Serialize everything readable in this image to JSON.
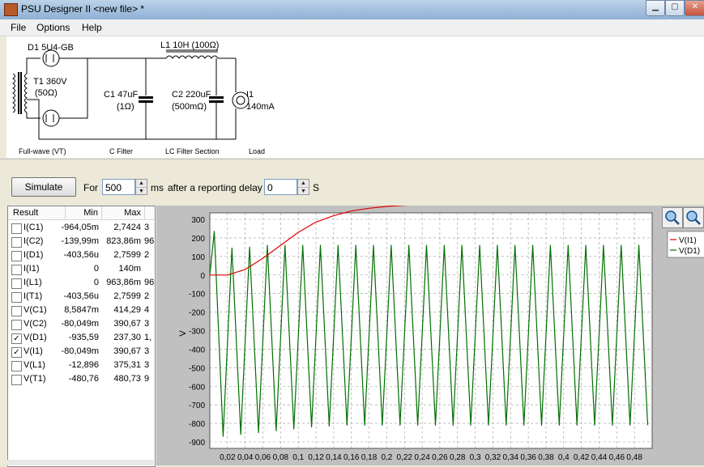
{
  "window": {
    "title": "PSU Designer II  <new file> *"
  },
  "menu": [
    "File",
    "Options",
    "Help"
  ],
  "schematic": {
    "d1_label": "D1 5U4-GB",
    "t1_label": "T1 360V",
    "t1_res": "(50Ω)",
    "l1_label": "L1 10H (100Ω)",
    "c1_label": "C1 47uF",
    "c1_res": "(1Ω)",
    "c2_label": "C2 220uF",
    "c2_res": "(500mΩ)",
    "i1_label": "I1",
    "i1_val": "140mA",
    "sections": [
      "Full-wave (VT)",
      "C Filter",
      "LC Filter Section",
      "Load"
    ]
  },
  "controls": {
    "simulate": "Simulate",
    "for_label": "For",
    "duration": "500",
    "ms_label": "ms",
    "delay_label": "after a reporting delay of",
    "delay": "0",
    "s_label": "S"
  },
  "results": {
    "headers": [
      "Result",
      "Min",
      "Max"
    ],
    "rows": [
      {
        "name": "I(C1)",
        "min": "-964,05m",
        "max": "2,7424",
        "extra": "3",
        "checked": false
      },
      {
        "name": "I(C2)",
        "min": "-139,99m",
        "max": "823,86m",
        "extra": "96",
        "checked": false
      },
      {
        "name": "I(D1)",
        "min": "-403,56u",
        "max": "2,7599",
        "extra": "2",
        "checked": false
      },
      {
        "name": "I(I1)",
        "min": "0",
        "max": "140m",
        "extra": "",
        "checked": false
      },
      {
        "name": "I(L1)",
        "min": "0",
        "max": "963,86m",
        "extra": "96",
        "checked": false
      },
      {
        "name": "I(T1)",
        "min": "-403,56u",
        "max": "2,7599",
        "extra": "2",
        "checked": false
      },
      {
        "name": "V(C1)",
        "min": "8,5847m",
        "max": "414,29",
        "extra": "4",
        "checked": false
      },
      {
        "name": "V(C2)",
        "min": "-80,049m",
        "max": "390,67",
        "extra": "3",
        "checked": false
      },
      {
        "name": "V(D1)",
        "min": "-935,59",
        "max": "237,30",
        "extra": "1,",
        "checked": true
      },
      {
        "name": "V(I1)",
        "min": "-80,049m",
        "max": "390,67",
        "extra": "3",
        "checked": true
      },
      {
        "name": "V(L1)",
        "min": "-12,896",
        "max": "375,31",
        "extra": "3",
        "checked": false
      },
      {
        "name": "V(T1)",
        "min": "-480,76",
        "max": "480,73",
        "extra": "9",
        "checked": false
      }
    ]
  },
  "chart_data": {
    "type": "line",
    "ylabel": "V",
    "xlim": [
      0,
      0.5
    ],
    "ylim": [
      -900,
      300
    ],
    "yticks": [
      300,
      200,
      100,
      0,
      -100,
      -200,
      -300,
      -400,
      -500,
      -600,
      -700,
      -800,
      -900
    ],
    "xticks": [
      "0,02",
      "0,04",
      "0,06",
      "0,08",
      "0,1",
      "0,12",
      "0,14",
      "0,16",
      "0,18",
      "0,2",
      "0,22",
      "0,24",
      "0,26",
      "0,28",
      "0,3",
      "0,32",
      "0,34",
      "0,36",
      "0,38",
      "0,4",
      "0,42",
      "0,44",
      "0,46",
      "0,48"
    ],
    "grid": true,
    "legend_position": "right",
    "series": [
      {
        "name": "V(I1)",
        "color": "#e00000",
        "x": [
          0,
          0.02,
          0.04,
          0.06,
          0.08,
          0.1,
          0.12,
          0.14,
          0.16,
          0.18,
          0.2,
          0.22,
          0.24,
          0.26,
          0.28,
          0.3,
          0.32,
          0.34,
          0.36,
          0.38,
          0.4,
          0.42
        ],
        "y": [
          0,
          0,
          30,
          90,
          160,
          230,
          285,
          320,
          345,
          360,
          370,
          376,
          380,
          383,
          385,
          386,
          387,
          388,
          389,
          389,
          390,
          390
        ]
      },
      {
        "name": "V(D1)",
        "color": "#007000",
        "x": [
          0.005,
          0.015,
          0.025,
          0.035,
          0.045,
          0.055,
          0.065,
          0.075,
          0.085,
          0.095,
          0.105,
          0.115,
          0.125,
          0.135,
          0.145,
          0.155,
          0.165,
          0.175,
          0.185,
          0.195,
          0.205,
          0.215,
          0.225,
          0.235,
          0.245,
          0.255,
          0.265,
          0.275,
          0.285,
          0.295,
          0.305,
          0.315,
          0.325,
          0.335,
          0.345,
          0.355,
          0.365,
          0.375,
          0.385,
          0.395,
          0.405,
          0.415,
          0.425,
          0.435,
          0.445,
          0.455,
          0.465,
          0.475,
          0.485,
          0.495
        ],
        "y": [
          235,
          -870,
          145,
          -860,
          150,
          -850,
          160,
          -840,
          160,
          -830,
          160,
          -820,
          160,
          -815,
          160,
          -810,
          160,
          -810,
          160,
          -810,
          160,
          -810,
          160,
          -810,
          160,
          -810,
          160,
          -810,
          160,
          -810,
          160,
          -810,
          160,
          -810,
          160,
          -810,
          160,
          -810,
          160,
          -810,
          160,
          -810,
          160,
          -810,
          160,
          -810,
          160,
          -810,
          160,
          -810
        ]
      }
    ]
  }
}
